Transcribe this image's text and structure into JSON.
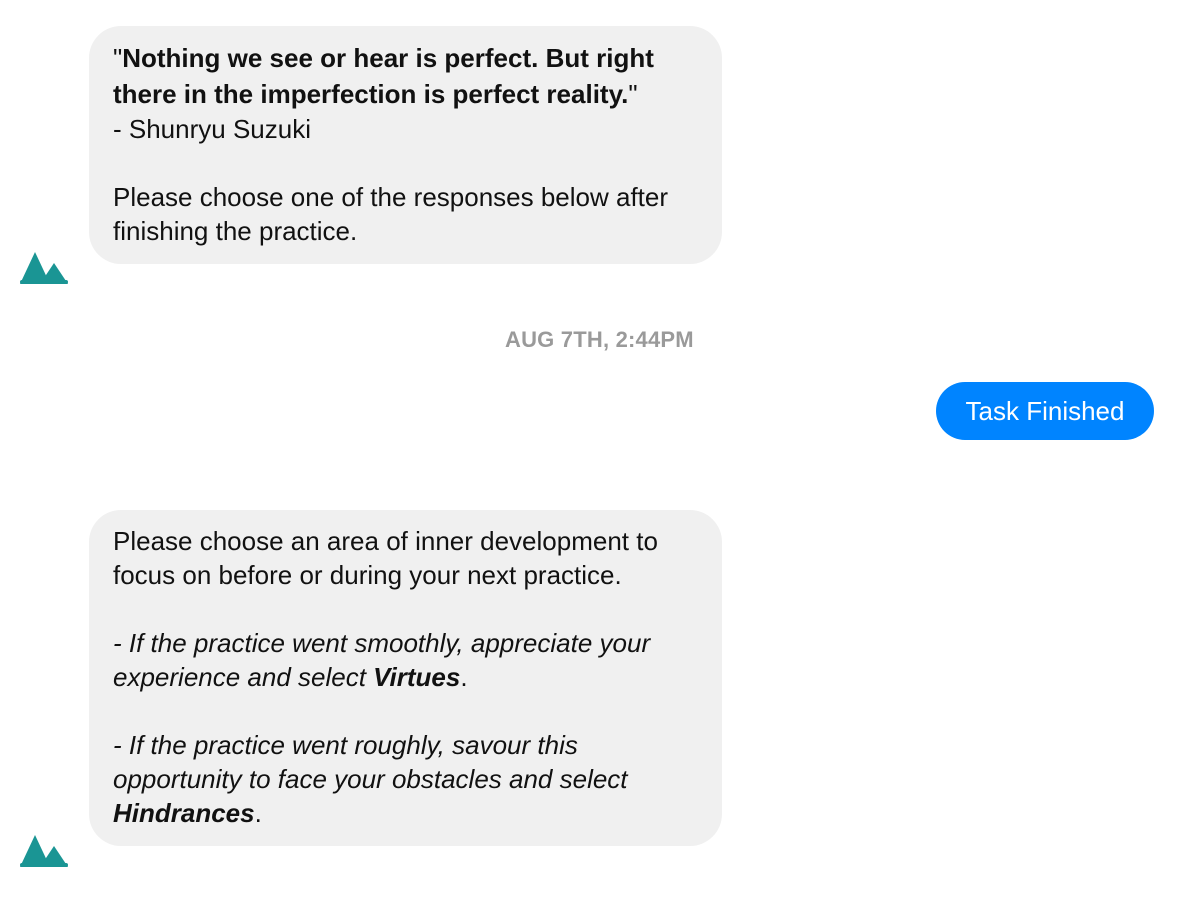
{
  "colors": {
    "bot_bubble": "#f0f0f0",
    "user_bubble": "#0084ff",
    "avatar": "#1a9594",
    "timestamp": "#9a9a9a"
  },
  "messages": {
    "first": {
      "avatar_icon": "mountain-logo-icon",
      "quote_open": "\"",
      "quote_text": "Nothing we see or hear is perfect. But right there in the imperfection is perfect reality.",
      "quote_close": "\"",
      "author": "- Shunryu Suzuki",
      "instruction": "Please choose one of the responses below after finishing the practice."
    },
    "timestamp": "AUG 7TH, 2:44PM",
    "user_reply": "Task Finished",
    "second": {
      "avatar_icon": "mountain-logo-icon",
      "intro": "Please choose an area of inner development to focus on before or during your next practice.",
      "virtues_prefix": "- If the practice went smoothly, appreciate your experience and select ",
      "virtues_keyword": "Virtues",
      "virtues_suffix": ".",
      "hindrances_prefix": "- If the practice went roughly, savour this opportunity to face your obstacles and select ",
      "hindrances_keyword": "Hindrances",
      "hindrances_suffix": "."
    }
  }
}
